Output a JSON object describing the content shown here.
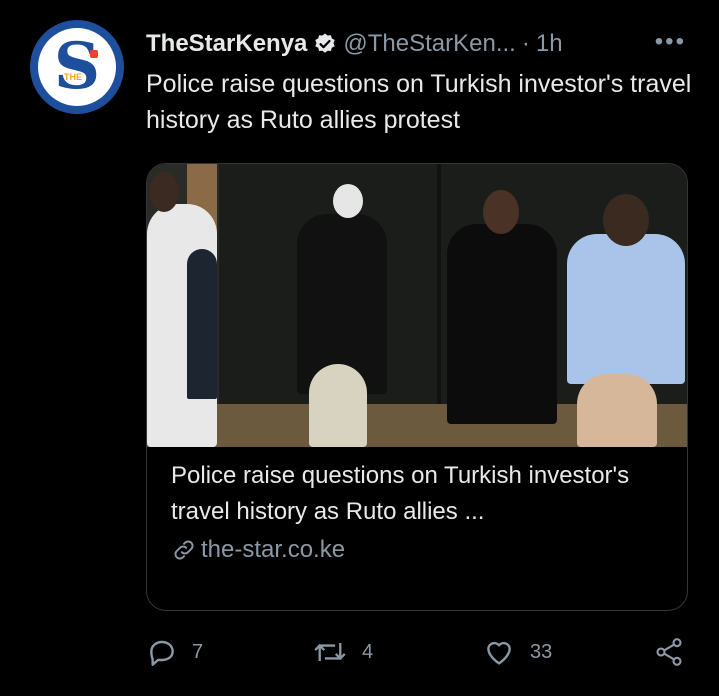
{
  "tweet": {
    "author_name": "TheStarKenya",
    "handle": "@TheStarKen...",
    "separator": "·",
    "time": "1h",
    "more_label": "•••",
    "text": "Police raise questions on Turkish investor's travel history as Ruto allies protest"
  },
  "card": {
    "title": "Police raise questions on Turkish investor's travel history as Ruto allies ...",
    "domain": "the-star.co.ke"
  },
  "actions": {
    "replies": "7",
    "retweets": "4",
    "likes": "33"
  },
  "colors": {
    "background": "#000000",
    "text": "#e7e9ea",
    "muted": "#8b98a5",
    "brand": "#1d4f9c"
  }
}
